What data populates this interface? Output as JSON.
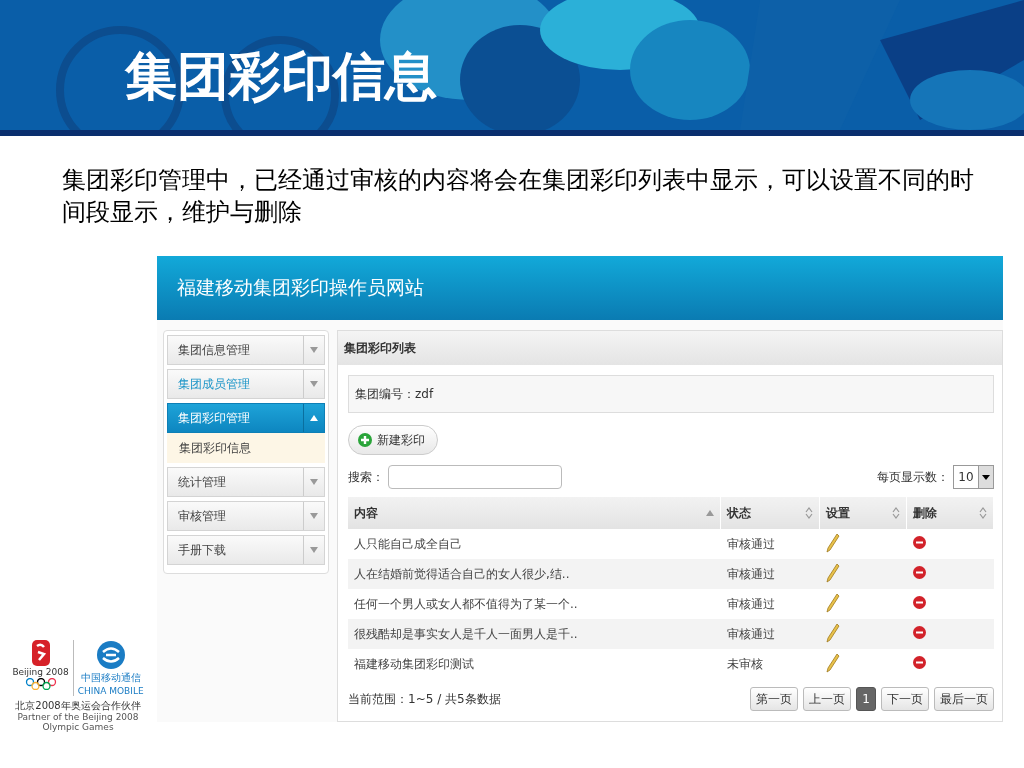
{
  "slide": {
    "title": "集团彩印信息",
    "description": "集团彩印管理中，已经通过审核的内容将会在集团彩印列表中显示，可以设置不同的时间段显示，维护与删除"
  },
  "site": {
    "title": "福建移动集团彩印操作员网站"
  },
  "sidebar": {
    "items": [
      {
        "label": "集团信息管理",
        "expanded": false,
        "selected": false,
        "hovered": false
      },
      {
        "label": "集团成员管理",
        "expanded": false,
        "selected": false,
        "hovered": true
      },
      {
        "label": "集团彩印管理",
        "expanded": true,
        "selected": true,
        "hovered": false,
        "children": [
          {
            "label": "集团彩印信息",
            "selected": true
          }
        ]
      },
      {
        "label": "统计管理",
        "expanded": false,
        "selected": false,
        "hovered": false
      },
      {
        "label": "审核管理",
        "expanded": false,
        "selected": false,
        "hovered": false
      },
      {
        "label": "手册下载",
        "expanded": false,
        "selected": false,
        "hovered": false
      }
    ]
  },
  "panel": {
    "title": "集团彩印列表",
    "group_label": "集团编号：",
    "group_value": "zdf",
    "new_button": "新建彩印",
    "search_label": "搜索：",
    "page_size_label": "每页显示数：",
    "page_size": "10",
    "table": {
      "columns": [
        {
          "label": "内容",
          "sorted": true
        },
        {
          "label": "状态",
          "sorted": false
        },
        {
          "label": "设置",
          "sorted": false
        },
        {
          "label": "删除",
          "sorted": false
        }
      ],
      "rows": [
        {
          "content": "人只能自己成全自己",
          "status": "审核通过"
        },
        {
          "content": "人在结婚前觉得适合自己的女人很少,结..",
          "status": "审核通过"
        },
        {
          "content": "任何一个男人或女人都不值得为了某一个..",
          "status": "审核通过"
        },
        {
          "content": "很残酷却是事实女人是千人一面男人是千..",
          "status": "审核通过"
        },
        {
          "content": "福建移动集团彩印测试",
          "status": "未审核"
        }
      ]
    },
    "range": "当前范围：1~5 / 共5条数据",
    "pager": [
      {
        "label": "第一页",
        "selected": false
      },
      {
        "label": "上一页",
        "selected": false
      },
      {
        "label": "1",
        "selected": true
      },
      {
        "label": "下一页",
        "selected": false
      },
      {
        "label": "最后一页",
        "selected": false
      }
    ]
  },
  "logos": {
    "games": "Beijing 2008",
    "operator_cn": "中国移动通信",
    "operator_en": "CHINA MOBILE",
    "partner_cn": "北京2008年奥运会合作伙伴",
    "partner_en": "Partner of the Beijing 2008 Olympic Games"
  }
}
